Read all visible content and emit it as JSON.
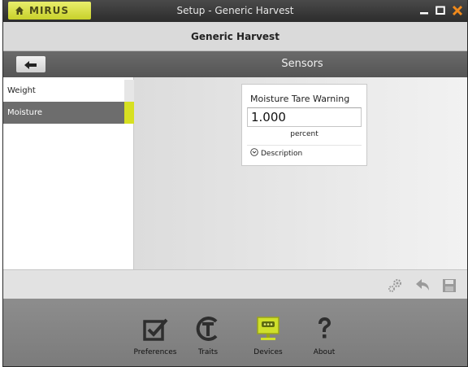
{
  "window": {
    "brand": "MIRUS",
    "title": "Setup - Generic Harvest",
    "controls": [
      "minimize-icon",
      "maximize-icon",
      "close-icon"
    ],
    "accent": "#d7e021"
  },
  "header": {
    "subtitle": "Generic Harvest"
  },
  "navbar": {
    "title": "Sensors",
    "back_icon": "arrow-left-icon"
  },
  "sidebar": {
    "items": [
      {
        "label": "Weight",
        "selected": false
      },
      {
        "label": "Moisture",
        "selected": true
      }
    ]
  },
  "card": {
    "title": "Moisture Tare Warning",
    "value": "1.000",
    "unit": "percent",
    "description_label": "Description"
  },
  "actions": [
    "gears-icon",
    "undo-icon",
    "save-icon"
  ],
  "bottom_nav": {
    "items": [
      {
        "label": "Preferences",
        "icon": "checkbox-icon"
      },
      {
        "label": "Traits",
        "icon": "traits-t-icon"
      },
      {
        "label": "Devices",
        "icon": "monitor-icon",
        "active": true
      },
      {
        "label": "About",
        "icon": "question-icon"
      }
    ]
  }
}
